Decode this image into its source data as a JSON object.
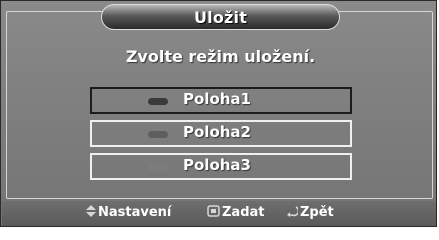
{
  "dialog": {
    "title": "Uložit",
    "prompt": "Zvolte režim uložení.",
    "options": [
      {
        "label": "Poloha1",
        "selected": true,
        "bullet_color": "#3a3a3a"
      },
      {
        "label": "Poloha2",
        "selected": false,
        "bullet_color": "#5e5e5e"
      },
      {
        "label": "Poloha3",
        "selected": false,
        "bullet_color": "#7c7c7c"
      }
    ]
  },
  "footer": {
    "move": {
      "icon": "up-down-arrows-icon",
      "label": "Nastavení"
    },
    "enter": {
      "icon": "enter-icon",
      "label": "Zadat"
    },
    "back": {
      "icon": "return-arrow-icon",
      "label": "Zpět"
    }
  },
  "colors": {
    "panel": "#7e7e7e",
    "footer": "#646464",
    "text": "#ffffff",
    "selected_border": "#1c1c1c",
    "unselected_border": "#f0f0f0"
  }
}
